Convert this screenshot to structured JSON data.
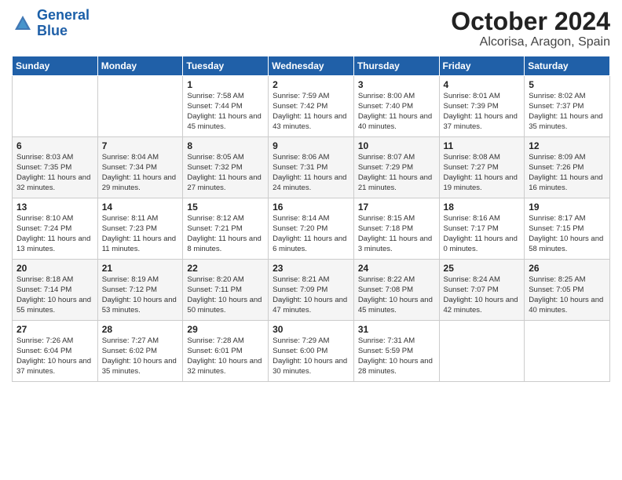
{
  "logo": {
    "line1": "General",
    "line2": "Blue"
  },
  "header": {
    "month": "October 2024",
    "location": "Alcorisa, Aragon, Spain"
  },
  "weekdays": [
    "Sunday",
    "Monday",
    "Tuesday",
    "Wednesday",
    "Thursday",
    "Friday",
    "Saturday"
  ],
  "weeks": [
    [
      {
        "day": "",
        "detail": ""
      },
      {
        "day": "",
        "detail": ""
      },
      {
        "day": "1",
        "detail": "Sunrise: 7:58 AM\nSunset: 7:44 PM\nDaylight: 11 hours\nand 45 minutes."
      },
      {
        "day": "2",
        "detail": "Sunrise: 7:59 AM\nSunset: 7:42 PM\nDaylight: 11 hours\nand 43 minutes."
      },
      {
        "day": "3",
        "detail": "Sunrise: 8:00 AM\nSunset: 7:40 PM\nDaylight: 11 hours\nand 40 minutes."
      },
      {
        "day": "4",
        "detail": "Sunrise: 8:01 AM\nSunset: 7:39 PM\nDaylight: 11 hours\nand 37 minutes."
      },
      {
        "day": "5",
        "detail": "Sunrise: 8:02 AM\nSunset: 7:37 PM\nDaylight: 11 hours\nand 35 minutes."
      }
    ],
    [
      {
        "day": "6",
        "detail": "Sunrise: 8:03 AM\nSunset: 7:35 PM\nDaylight: 11 hours\nand 32 minutes."
      },
      {
        "day": "7",
        "detail": "Sunrise: 8:04 AM\nSunset: 7:34 PM\nDaylight: 11 hours\nand 29 minutes."
      },
      {
        "day": "8",
        "detail": "Sunrise: 8:05 AM\nSunset: 7:32 PM\nDaylight: 11 hours\nand 27 minutes."
      },
      {
        "day": "9",
        "detail": "Sunrise: 8:06 AM\nSunset: 7:31 PM\nDaylight: 11 hours\nand 24 minutes."
      },
      {
        "day": "10",
        "detail": "Sunrise: 8:07 AM\nSunset: 7:29 PM\nDaylight: 11 hours\nand 21 minutes."
      },
      {
        "day": "11",
        "detail": "Sunrise: 8:08 AM\nSunset: 7:27 PM\nDaylight: 11 hours\nand 19 minutes."
      },
      {
        "day": "12",
        "detail": "Sunrise: 8:09 AM\nSunset: 7:26 PM\nDaylight: 11 hours\nand 16 minutes."
      }
    ],
    [
      {
        "day": "13",
        "detail": "Sunrise: 8:10 AM\nSunset: 7:24 PM\nDaylight: 11 hours\nand 13 minutes."
      },
      {
        "day": "14",
        "detail": "Sunrise: 8:11 AM\nSunset: 7:23 PM\nDaylight: 11 hours\nand 11 minutes."
      },
      {
        "day": "15",
        "detail": "Sunrise: 8:12 AM\nSunset: 7:21 PM\nDaylight: 11 hours\nand 8 minutes."
      },
      {
        "day": "16",
        "detail": "Sunrise: 8:14 AM\nSunset: 7:20 PM\nDaylight: 11 hours\nand 6 minutes."
      },
      {
        "day": "17",
        "detail": "Sunrise: 8:15 AM\nSunset: 7:18 PM\nDaylight: 11 hours\nand 3 minutes."
      },
      {
        "day": "18",
        "detail": "Sunrise: 8:16 AM\nSunset: 7:17 PM\nDaylight: 11 hours\nand 0 minutes."
      },
      {
        "day": "19",
        "detail": "Sunrise: 8:17 AM\nSunset: 7:15 PM\nDaylight: 10 hours\nand 58 minutes."
      }
    ],
    [
      {
        "day": "20",
        "detail": "Sunrise: 8:18 AM\nSunset: 7:14 PM\nDaylight: 10 hours\nand 55 minutes."
      },
      {
        "day": "21",
        "detail": "Sunrise: 8:19 AM\nSunset: 7:12 PM\nDaylight: 10 hours\nand 53 minutes."
      },
      {
        "day": "22",
        "detail": "Sunrise: 8:20 AM\nSunset: 7:11 PM\nDaylight: 10 hours\nand 50 minutes."
      },
      {
        "day": "23",
        "detail": "Sunrise: 8:21 AM\nSunset: 7:09 PM\nDaylight: 10 hours\nand 47 minutes."
      },
      {
        "day": "24",
        "detail": "Sunrise: 8:22 AM\nSunset: 7:08 PM\nDaylight: 10 hours\nand 45 minutes."
      },
      {
        "day": "25",
        "detail": "Sunrise: 8:24 AM\nSunset: 7:07 PM\nDaylight: 10 hours\nand 42 minutes."
      },
      {
        "day": "26",
        "detail": "Sunrise: 8:25 AM\nSunset: 7:05 PM\nDaylight: 10 hours\nand 40 minutes."
      }
    ],
    [
      {
        "day": "27",
        "detail": "Sunrise: 7:26 AM\nSunset: 6:04 PM\nDaylight: 10 hours\nand 37 minutes."
      },
      {
        "day": "28",
        "detail": "Sunrise: 7:27 AM\nSunset: 6:02 PM\nDaylight: 10 hours\nand 35 minutes."
      },
      {
        "day": "29",
        "detail": "Sunrise: 7:28 AM\nSunset: 6:01 PM\nDaylight: 10 hours\nand 32 minutes."
      },
      {
        "day": "30",
        "detail": "Sunrise: 7:29 AM\nSunset: 6:00 PM\nDaylight: 10 hours\nand 30 minutes."
      },
      {
        "day": "31",
        "detail": "Sunrise: 7:31 AM\nSunset: 5:59 PM\nDaylight: 10 hours\nand 28 minutes."
      },
      {
        "day": "",
        "detail": ""
      },
      {
        "day": "",
        "detail": ""
      }
    ]
  ]
}
